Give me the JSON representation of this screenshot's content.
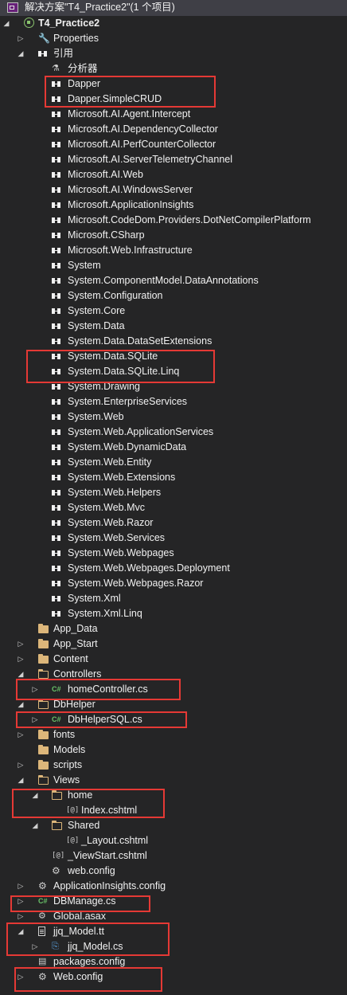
{
  "solution": {
    "title": "解决方案\"T4_Practice2\"(1 个项目)"
  },
  "rows": [
    {
      "label": "T4_Practice2",
      "arrow": "open",
      "icon": "project",
      "level": 0,
      "bold": true
    },
    {
      "label": "Properties",
      "arrow": "closed",
      "icon": "wrench",
      "level": 1
    },
    {
      "label": "引用",
      "arrow": "open",
      "icon": "ref",
      "level": 1
    },
    {
      "label": "分析器",
      "arrow": "none",
      "icon": "analyzer",
      "level": 2
    },
    {
      "label": "Dapper",
      "arrow": "none",
      "icon": "ref",
      "level": 2
    },
    {
      "label": "Dapper.SimpleCRUD",
      "arrow": "none",
      "icon": "ref",
      "level": 2
    },
    {
      "label": "Microsoft.AI.Agent.Intercept",
      "arrow": "none",
      "icon": "ref",
      "level": 2
    },
    {
      "label": "Microsoft.AI.DependencyCollector",
      "arrow": "none",
      "icon": "ref",
      "level": 2
    },
    {
      "label": "Microsoft.AI.PerfCounterCollector",
      "arrow": "none",
      "icon": "ref",
      "level": 2
    },
    {
      "label": "Microsoft.AI.ServerTelemetryChannel",
      "arrow": "none",
      "icon": "ref",
      "level": 2
    },
    {
      "label": "Microsoft.AI.Web",
      "arrow": "none",
      "icon": "ref",
      "level": 2
    },
    {
      "label": "Microsoft.AI.WindowsServer",
      "arrow": "none",
      "icon": "ref",
      "level": 2
    },
    {
      "label": "Microsoft.ApplicationInsights",
      "arrow": "none",
      "icon": "ref",
      "level": 2
    },
    {
      "label": "Microsoft.CodeDom.Providers.DotNetCompilerPlatform",
      "arrow": "none",
      "icon": "ref",
      "level": 2
    },
    {
      "label": "Microsoft.CSharp",
      "arrow": "none",
      "icon": "ref",
      "level": 2
    },
    {
      "label": "Microsoft.Web.Infrastructure",
      "arrow": "none",
      "icon": "ref",
      "level": 2
    },
    {
      "label": "System",
      "arrow": "none",
      "icon": "ref",
      "level": 2
    },
    {
      "label": "System.ComponentModel.DataAnnotations",
      "arrow": "none",
      "icon": "ref",
      "level": 2
    },
    {
      "label": "System.Configuration",
      "arrow": "none",
      "icon": "ref",
      "level": 2
    },
    {
      "label": "System.Core",
      "arrow": "none",
      "icon": "ref",
      "level": 2
    },
    {
      "label": "System.Data",
      "arrow": "none",
      "icon": "ref",
      "level": 2
    },
    {
      "label": "System.Data.DataSetExtensions",
      "arrow": "none",
      "icon": "ref",
      "level": 2
    },
    {
      "label": "System.Data.SQLite",
      "arrow": "none",
      "icon": "ref",
      "level": 2
    },
    {
      "label": "System.Data.SQLite.Linq",
      "arrow": "none",
      "icon": "ref",
      "level": 2
    },
    {
      "label": "System.Drawing",
      "arrow": "none",
      "icon": "ref",
      "level": 2
    },
    {
      "label": "System.EnterpriseServices",
      "arrow": "none",
      "icon": "ref",
      "level": 2
    },
    {
      "label": "System.Web",
      "arrow": "none",
      "icon": "ref",
      "level": 2
    },
    {
      "label": "System.Web.ApplicationServices",
      "arrow": "none",
      "icon": "ref",
      "level": 2
    },
    {
      "label": "System.Web.DynamicData",
      "arrow": "none",
      "icon": "ref",
      "level": 2
    },
    {
      "label": "System.Web.Entity",
      "arrow": "none",
      "icon": "ref",
      "level": 2
    },
    {
      "label": "System.Web.Extensions",
      "arrow": "none",
      "icon": "ref",
      "level": 2
    },
    {
      "label": "System.Web.Helpers",
      "arrow": "none",
      "icon": "ref",
      "level": 2
    },
    {
      "label": "System.Web.Mvc",
      "arrow": "none",
      "icon": "ref",
      "level": 2
    },
    {
      "label": "System.Web.Razor",
      "arrow": "none",
      "icon": "ref",
      "level": 2
    },
    {
      "label": "System.Web.Services",
      "arrow": "none",
      "icon": "ref",
      "level": 2
    },
    {
      "label": "System.Web.Webpages",
      "arrow": "none",
      "icon": "ref",
      "level": 2
    },
    {
      "label": "System.Web.Webpages.Deployment",
      "arrow": "none",
      "icon": "ref",
      "level": 2
    },
    {
      "label": "System.Web.Webpages.Razor",
      "arrow": "none",
      "icon": "ref",
      "level": 2
    },
    {
      "label": "System.Xml",
      "arrow": "none",
      "icon": "ref",
      "level": 2
    },
    {
      "label": "System.Xml.Linq",
      "arrow": "none",
      "icon": "ref",
      "level": 2
    },
    {
      "label": "App_Data",
      "arrow": "none",
      "icon": "folder",
      "level": 1
    },
    {
      "label": "App_Start",
      "arrow": "closed",
      "icon": "folder",
      "level": 1
    },
    {
      "label": "Content",
      "arrow": "closed",
      "icon": "folder",
      "level": 1
    },
    {
      "label": "Controllers",
      "arrow": "open",
      "icon": "folder-open",
      "level": 1
    },
    {
      "label": "homeController.cs",
      "arrow": "closed",
      "icon": "cs",
      "level": 2
    },
    {
      "label": "DbHelper",
      "arrow": "open",
      "icon": "folder-open",
      "level": 1
    },
    {
      "label": "DbHelperSQL.cs",
      "arrow": "closed",
      "icon": "cs",
      "level": 2
    },
    {
      "label": "fonts",
      "arrow": "closed",
      "icon": "folder",
      "level": 1
    },
    {
      "label": "Models",
      "arrow": "none",
      "icon": "folder",
      "level": 1
    },
    {
      "label": "scripts",
      "arrow": "closed",
      "icon": "folder",
      "level": 1
    },
    {
      "label": "Views",
      "arrow": "open",
      "icon": "folder-open",
      "level": 1
    },
    {
      "label": "home",
      "arrow": "open",
      "icon": "folder-open",
      "level": 2
    },
    {
      "label": "Index.cshtml",
      "arrow": "none",
      "icon": "cshtml",
      "level": 3
    },
    {
      "label": "Shared",
      "arrow": "open",
      "icon": "folder-open",
      "level": 2
    },
    {
      "label": "_Layout.cshtml",
      "arrow": "none",
      "icon": "cshtml",
      "level": 3
    },
    {
      "label": "_ViewStart.cshtml",
      "arrow": "none",
      "icon": "cshtml",
      "level": 2
    },
    {
      "label": "web.config",
      "arrow": "none",
      "icon": "config",
      "level": 2
    },
    {
      "label": "ApplicationInsights.config",
      "arrow": "closed",
      "icon": "config",
      "level": 1
    },
    {
      "label": "DBManage.cs",
      "arrow": "closed",
      "icon": "cs",
      "level": 1
    },
    {
      "label": "Global.asax",
      "arrow": "closed",
      "icon": "asax",
      "level": 1
    },
    {
      "label": "jjq_Model.tt",
      "arrow": "open",
      "icon": "tt",
      "level": 1
    },
    {
      "label": "jjq_Model.cs",
      "arrow": "closed",
      "icon": "csgen",
      "level": 2
    },
    {
      "label": "packages.config",
      "arrow": "none",
      "icon": "pkg",
      "level": 1
    },
    {
      "label": "Web.config",
      "arrow": "closed",
      "icon": "config",
      "level": 1
    }
  ],
  "colors": {
    "background": "#252526",
    "text": "#f1f1f1",
    "highlight_box": "#e53935",
    "folder": "#dcb67a",
    "csharp": "#68c168"
  }
}
